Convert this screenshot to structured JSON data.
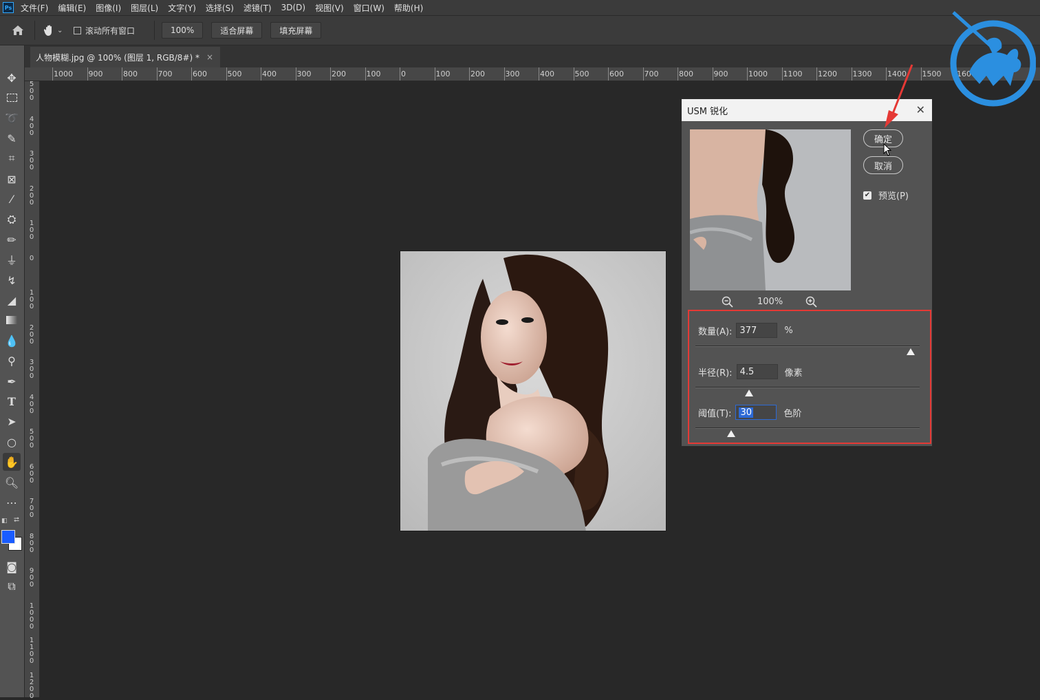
{
  "menubar": {
    "app_icon": "Ps",
    "items": [
      "文件(F)",
      "编辑(E)",
      "图像(I)",
      "图层(L)",
      "文字(Y)",
      "选择(S)",
      "滤镜(T)",
      "3D(D)",
      "视图(V)",
      "窗口(W)",
      "帮助(H)"
    ]
  },
  "options": {
    "scroll_all": "滚动所有窗口",
    "zoom": "100%",
    "fit_screen": "适合屏幕",
    "fill_screen": "填充屏幕"
  },
  "document": {
    "tab_title": "人物模糊.jpg @ 100% (图层 1, RGB/8#) *",
    "close": "×"
  },
  "ruler": {
    "h_labels": [
      "1000",
      "900",
      "800",
      "700",
      "600",
      "500",
      "400",
      "300",
      "200",
      "100",
      "0",
      "100",
      "200",
      "300",
      "400",
      "500",
      "600",
      "700",
      "800",
      "900",
      "1000",
      "1100",
      "1200",
      "1300",
      "1400",
      "1500",
      "1600"
    ],
    "v_labels": [
      "500",
      "400",
      "300",
      "200",
      "100",
      "0",
      "100",
      "200",
      "300",
      "400",
      "500",
      "600",
      "700",
      "800",
      "900",
      "1000",
      "1100",
      "1200"
    ]
  },
  "dialog": {
    "title": "USM 锐化",
    "close": "✕",
    "ok": "确定",
    "cancel": "取消",
    "preview_label": "预览(P)",
    "zoom_value": "100%",
    "amount": {
      "label": "数量(A):",
      "value": "377",
      "unit": "%",
      "level": 0.96
    },
    "radius": {
      "label": "半径(R):",
      "value": "4.5",
      "unit": "像素",
      "level": 0.24
    },
    "threshold": {
      "label": "阈值(T):",
      "value": "30",
      "unit": "色阶",
      "level": 0.16
    }
  },
  "colors": {
    "accent_red": "#e53935",
    "foreground": "#1a5cff",
    "background": "#ffffff",
    "logo_blue": "#2b8fe0"
  }
}
